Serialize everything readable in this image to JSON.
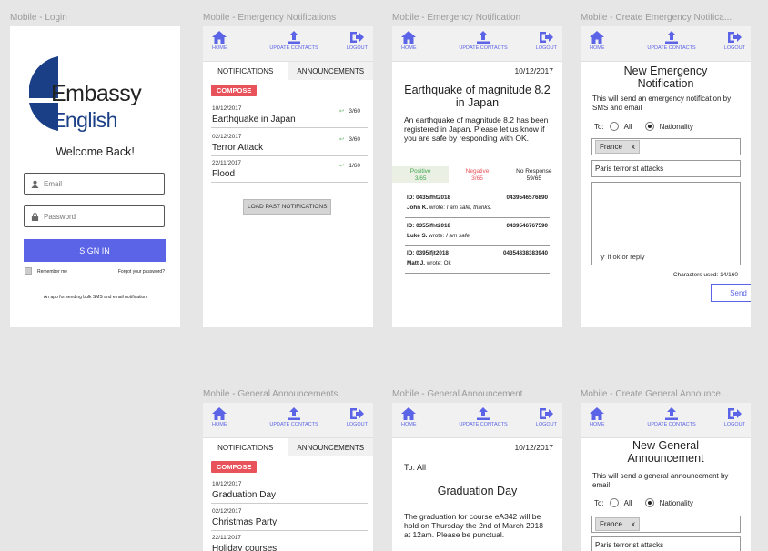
{
  "screens": {
    "login_label": "Mobile - Login",
    "notifs_label": "Mobile - Emergency Notifications",
    "notif_label": "Mobile - Emergency Notification",
    "create_label": "Mobile - Create Emergency Notifica...",
    "ga_label": "Mobile - General Announcements",
    "ann_label": "Mobile - General Announcement",
    "create_ga_label": "Mobile - Create General Announce..."
  },
  "nav": {
    "home": "HOME",
    "update": "UPDATE CONTACTS",
    "logout": "LOGOUT"
  },
  "login": {
    "brand1": "Embassy",
    "brand2": "English",
    "welcome": "Welcome Back!",
    "email_ph": "Email",
    "password_ph": "Password",
    "signin": "SIGN IN",
    "remember": "Remember me",
    "forgot": "Forgot your password?",
    "footer": "An app for sending bulk SMS and email notification"
  },
  "tabs": {
    "notifications": "NOTIFICATIONS",
    "announcements": "ANNOUNCEMENTS"
  },
  "compose": "COMPOSE",
  "notifications": [
    {
      "date": "10/12/2017",
      "title": "Earthquake in Japan",
      "count": "3/60"
    },
    {
      "date": "02/12/2017",
      "title": "Terror Attack",
      "count": "3/60"
    },
    {
      "date": "22/11/2017",
      "title": "Flood",
      "count": "1/60"
    }
  ],
  "load_past": "LOAD PAST NOTIFICATIONS",
  "detail": {
    "date": "10/12/2017",
    "title": "Earthquake of magnitude 8.2 in Japan",
    "body": "An earthquake of magnitude 8.2 has been registered in Japan. Please let us know if you are safe by responding with OK.",
    "positive": "Positive",
    "positive_n": "3/65",
    "negative": "Negative",
    "negative_n": "3/65",
    "noresp": "No Response",
    "noresp_n": "59/65",
    "replies": [
      {
        "id": "ID: 0435ifht2018",
        "phone": "0439546576890",
        "name": "John K.",
        "wrote": "wrote:",
        "msg": "I am safe, thanks."
      },
      {
        "id": "ID: 0355ifht2018",
        "phone": "0439546767590",
        "name": "Luke S.",
        "wrote": "wrote:",
        "msg": "I am safe."
      },
      {
        "id": "ID: 0395ifjt2018",
        "phone": "04354838383940",
        "name": "Matt J.",
        "wrote": "wrote:",
        "msg": "Ok"
      }
    ]
  },
  "create": {
    "title": "New Emergency Notification",
    "hint": "This will send an emergency notification by SMS and email",
    "to": "To:",
    "all": "All",
    "nationality": "Nationality",
    "chip": "France",
    "chip_x": "x",
    "subject": "Paris terrorist attacks",
    "placeholder": "'y' if ok or reply",
    "chars": "Characters used: 14/160",
    "send": "Send"
  },
  "announcements": [
    {
      "date": "10/12/2017",
      "title": "Graduation Day"
    },
    {
      "date": "02/12/2017",
      "title": "Christmas Party"
    },
    {
      "date": "22/11/2017",
      "title": "Holiday courses"
    }
  ],
  "announcement": {
    "date": "10/12/2017",
    "to": "To: All",
    "title": "Graduation Day",
    "body": "The graduation for course eA342 will be hold on Thursday the 2nd of March 2018 at 12am. Please be punctual."
  },
  "create_ga": {
    "title": "New General Announcement",
    "hint": "This will send a general announcement by email",
    "to": "To:",
    "all": "All",
    "nationality": "Nationality",
    "chip": "France",
    "chip_x": "x",
    "subject": "Paris terrorist attacks"
  },
  "colors": {
    "accent": "#5b63e6",
    "compose": "#e8525a",
    "positive": "#3fa34d",
    "negative": "#e8525a"
  }
}
